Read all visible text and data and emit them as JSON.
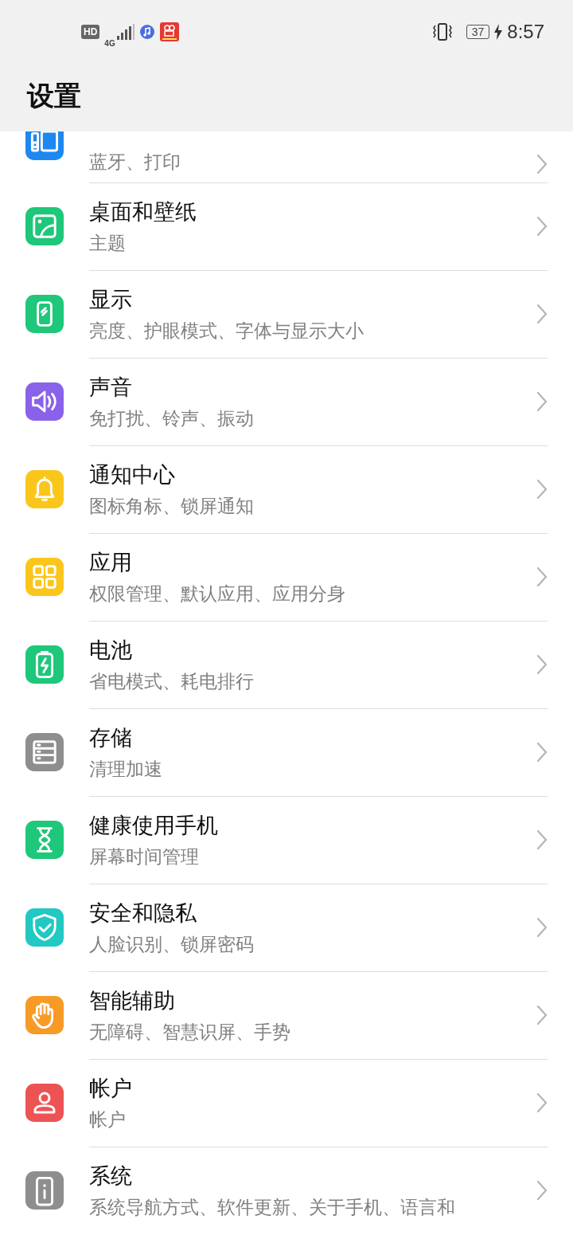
{
  "status_bar": {
    "network_badge": "HD",
    "network_type": "4G",
    "battery": "37",
    "time": "8:57"
  },
  "header": {
    "title": "设置"
  },
  "items": [
    {
      "kind": "devices",
      "color": "#1e88f0",
      "subtitle": "蓝牙、打印"
    },
    {
      "kind": "wallpaper",
      "color": "#1ec77a",
      "title": "桌面和壁纸",
      "subtitle": "主题"
    },
    {
      "kind": "display",
      "color": "#1ec77a",
      "title": "显示",
      "subtitle": "亮度、护眼模式、字体与显示大小"
    },
    {
      "kind": "sound",
      "color": "#8a62ea",
      "title": "声音",
      "subtitle": "免打扰、铃声、振动"
    },
    {
      "kind": "bell",
      "color": "#fbc61c",
      "title": "通知中心",
      "subtitle": "图标角标、锁屏通知"
    },
    {
      "kind": "apps",
      "color": "#fbc61c",
      "title": "应用",
      "subtitle": "权限管理、默认应用、应用分身"
    },
    {
      "kind": "battery",
      "color": "#1ec77a",
      "title": "电池",
      "subtitle": "省电模式、耗电排行"
    },
    {
      "kind": "storage",
      "color": "#8e8e8e",
      "title": "存储",
      "subtitle": "清理加速"
    },
    {
      "kind": "hourglass",
      "color": "#1ec77a",
      "title": "健康使用手机",
      "subtitle": "屏幕时间管理"
    },
    {
      "kind": "shield",
      "color": "#22c8c2",
      "title": "安全和隐私",
      "subtitle": "人脸识别、锁屏密码"
    },
    {
      "kind": "hand",
      "color": "#f79a26",
      "title": "智能辅助",
      "subtitle": "无障碍、智慧识屏、手势"
    },
    {
      "kind": "account",
      "color": "#ee5353",
      "title": "帐户",
      "subtitle": "帐户"
    },
    {
      "kind": "system",
      "color": "#8e8e8e",
      "title": "系统",
      "subtitle": "系统导航方式、软件更新、关于手机、语言和"
    }
  ]
}
